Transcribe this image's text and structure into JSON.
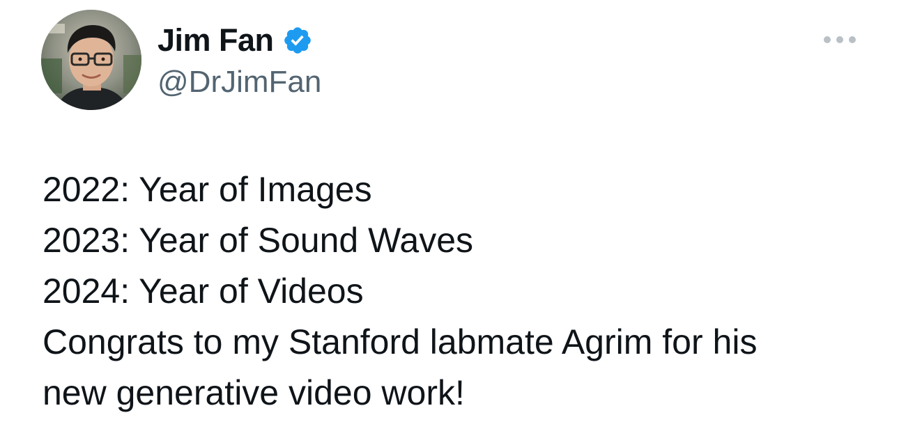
{
  "author": {
    "display_name": "Jim Fan",
    "handle": "@DrJimFan",
    "verified": true,
    "avatar_icon": "profile-photo"
  },
  "more_menu": {
    "icon": "more-horizontal-icon"
  },
  "tweet": {
    "lines": [
      "2022: Year of Images",
      "2023: Year of Sound Waves",
      "2024: Year of Videos",
      "Congrats to my Stanford labmate Agrim for his",
      "new generative video work!"
    ]
  },
  "colors": {
    "text_primary": "#0f1419",
    "text_secondary": "#536471",
    "verified_blue": "#1d9bf0",
    "more_dots": "#b9c0c6"
  }
}
